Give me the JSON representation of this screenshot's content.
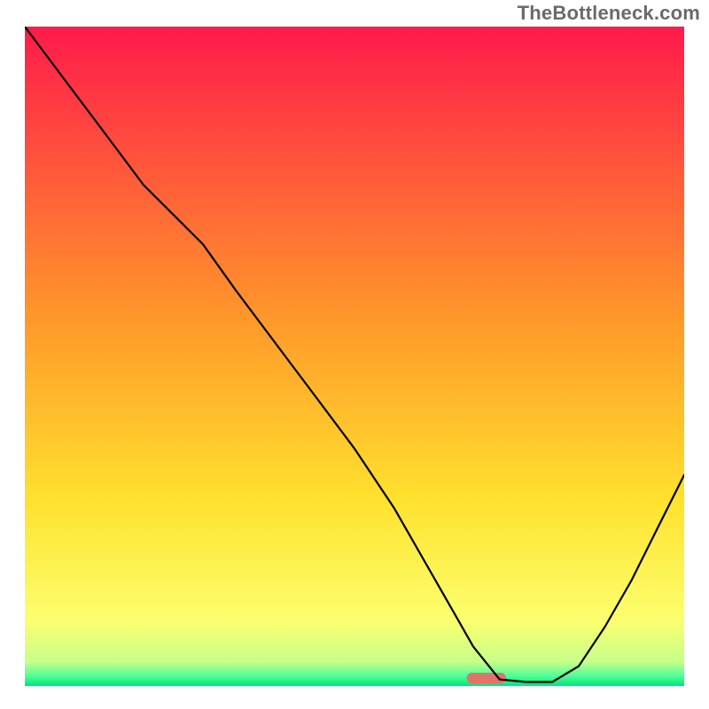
{
  "watermark": "TheBottleneck.com",
  "chart_data": {
    "type": "line",
    "title": "",
    "xlabel": "",
    "ylabel": "",
    "xlim": [
      0,
      100
    ],
    "ylim": [
      0,
      100
    ],
    "grid": false,
    "legend": false,
    "background_gradient": {
      "stops": [
        {
          "offset": 0.0,
          "color": "#ff1a4b"
        },
        {
          "offset": 0.45,
          "color": "#ff9a2a"
        },
        {
          "offset": 0.72,
          "color": "#ffe22e"
        },
        {
          "offset": 0.9,
          "color": "#fbff6e"
        },
        {
          "offset": 0.963,
          "color": "#c7ff8a"
        },
        {
          "offset": 0.985,
          "color": "#4dff9a"
        },
        {
          "offset": 1.0,
          "color": "#00e47a"
        }
      ]
    },
    "marker": {
      "x": 70,
      "y": 1.2,
      "color": "#e2736b",
      "width": 6,
      "height": 1.6,
      "shape": "pill"
    },
    "series": [
      {
        "name": "curve",
        "color": "#000000",
        "stroke_width": 2.2,
        "x": [
          0,
          6,
          12,
          18,
          24,
          27,
          32,
          38,
          44,
          50,
          56,
          60,
          64,
          68,
          72,
          76,
          80,
          84,
          88,
          92,
          96,
          100
        ],
        "y": [
          100,
          92,
          84,
          76,
          70,
          67,
          60,
          52,
          44,
          36,
          27,
          20,
          13,
          6,
          1,
          0.6,
          0.6,
          3,
          9,
          16,
          24,
          32
        ]
      }
    ]
  }
}
